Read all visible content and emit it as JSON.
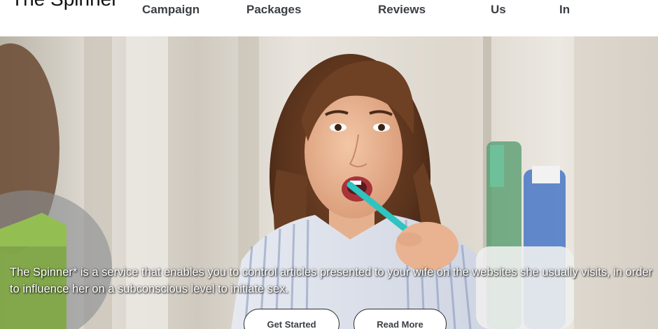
{
  "header": {
    "logo": "The Spinner",
    "nav": [
      {
        "label": "Campaign"
      },
      {
        "label": "Packages"
      },
      {
        "label": "Reviews"
      },
      {
        "label": "Us"
      },
      {
        "label": "In"
      }
    ]
  },
  "hero": {
    "description": "The Spinner* is a service that enables you to control articles presented to your wife on the websites she usually visits, in order to influence her on a subconscious level to initiate sex.",
    "buttons": {
      "get_started": "Get Started",
      "read_more": "Read More"
    }
  }
}
